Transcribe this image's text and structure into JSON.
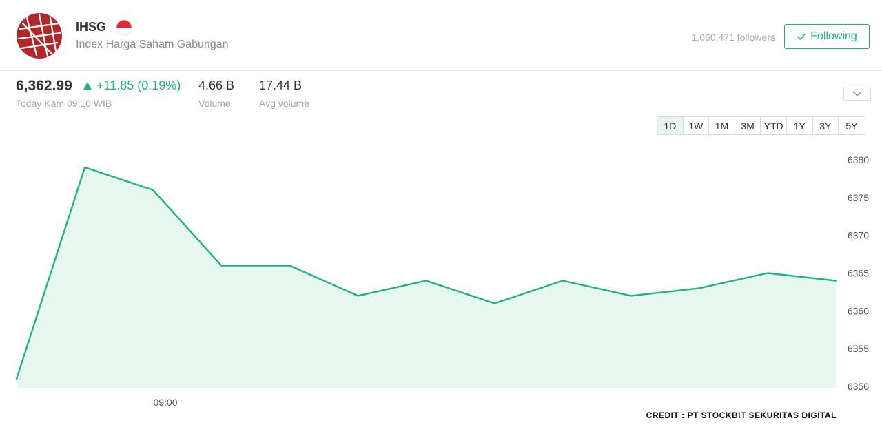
{
  "header": {
    "ticker": "IHSG",
    "company_name": "Index Harga Saham Gabungan",
    "followers": "1,060,471 followers",
    "follow_button": "Following",
    "logo_icon": "ihsg-logo-icon",
    "flag_icon": "indonesia-flag-icon"
  },
  "stats": {
    "price": "6,362.99",
    "change": "+11.85 (0.19%)",
    "change_direction": "up",
    "timestamp": "Today Kam 09:10 WIB",
    "volume_value": "4.66 B",
    "volume_label": "Volume",
    "avg_volume_value": "17.44 B",
    "avg_volume_label": "Avg volume"
  },
  "tabs": [
    "1D",
    "1W",
    "1M",
    "3M",
    "YTD",
    "1Y",
    "3Y",
    "5Y"
  ],
  "active_tab": "1D",
  "colors": {
    "accent": "#1fb47d",
    "fill": "#e5f7ee",
    "logo": "#b3262a"
  },
  "chart_data": {
    "type": "area",
    "x_ticks": [
      "09:00"
    ],
    "y_ticks": [
      "6380",
      "6375",
      "6370",
      "6365",
      "6360",
      "6355",
      "6350"
    ],
    "ylim": [
      6350,
      6380
    ],
    "series": [
      {
        "values": [
          6351,
          6379,
          6376,
          6366,
          6366,
          6362,
          6364,
          6361,
          6364,
          6362,
          6363,
          6365,
          6364
        ]
      }
    ]
  },
  "credit": "CREDIT : PT STOCKBIT SEKURITAS DIGITAL"
}
